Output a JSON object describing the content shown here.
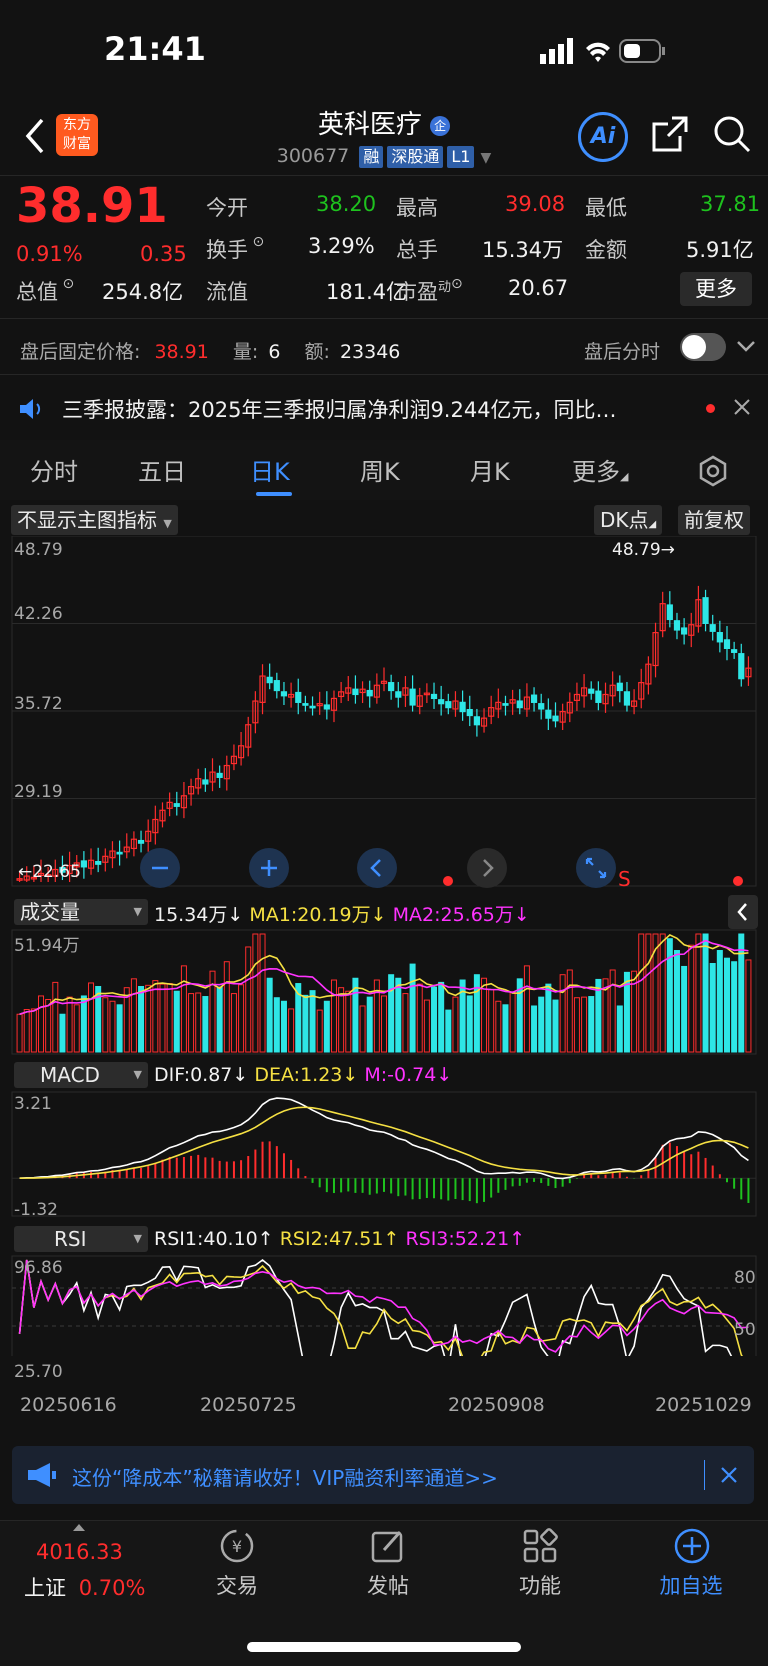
{
  "status": {
    "time": "21:41"
  },
  "header": {
    "logo_line1": "东方",
    "logo_line2": "财富",
    "title": "英科医疗",
    "title_badge": "企",
    "code": "300677",
    "tags": [
      "融",
      "深股通",
      "L1"
    ],
    "ai_label": "Ai"
  },
  "quote": {
    "price": "38.91",
    "change_pct": "0.91%",
    "change": "0.35",
    "open_label": "今开",
    "open": "38.20",
    "high_label": "最高",
    "high": "39.08",
    "low_label": "最低",
    "low": "37.81",
    "turnover_label": "换手",
    "turnover": "3.29%",
    "volume_label": "总手",
    "volume": "15.34万",
    "amount_label": "金额",
    "amount": "5.91亿",
    "mcap_label": "总值",
    "mcap": "254.8亿",
    "float_label": "流值",
    "float": "181.4亿",
    "pe_label": "市盈",
    "pe_sup": "动",
    "pe": "20.67",
    "more_label": "更多"
  },
  "afterhours": {
    "price_label": "盘后固定价格:",
    "price": "38.91",
    "qty_label": "量:",
    "qty": "6",
    "amt_label": "额:",
    "amt": "23346",
    "timeshare_label": "盘后分时"
  },
  "news": {
    "text": "三季报披露：2025年三季报归属净利润9.244亿元，同比…"
  },
  "tabs": [
    {
      "label": "分时"
    },
    {
      "label": "五日"
    },
    {
      "label": "日K"
    },
    {
      "label": "周K"
    },
    {
      "label": "月K"
    },
    {
      "label": "更多"
    }
  ],
  "chart_toolbar": {
    "indicator": "不显示主图指标",
    "dk": "DK点",
    "adjust": "前复权"
  },
  "chart_data": [
    {
      "type": "candlestick",
      "y_ticks": [
        "48.79",
        "42.26",
        "35.72",
        "29.19",
        "22.65"
      ],
      "ylim": [
        22.65,
        48.79
      ],
      "max_label": "48.79→",
      "min_label": "←22.65",
      "x_ticks": [
        "20250616",
        "20250725",
        "20250908",
        "20251029"
      ],
      "close": [
        22.9,
        23.1,
        23.0,
        23.3,
        23.2,
        23.6,
        23.4,
        23.9,
        24.1,
        23.8,
        24.3,
        24.0,
        24.6,
        25.0,
        24.8,
        25.3,
        25.9,
        25.6,
        26.5,
        27.4,
        28.1,
        28.7,
        28.4,
        29.2,
        29.9,
        30.5,
        30.1,
        31.0,
        30.6,
        31.5,
        32.2,
        33.0,
        34.6,
        36.4,
        38.3,
        37.8,
        37.2,
        36.8,
        36.9,
        36.3,
        36.1,
        35.9,
        36.2,
        35.8,
        36.6,
        37.1,
        37.4,
        36.9,
        37.3,
        36.8,
        37.6,
        37.9,
        37.2,
        36.7,
        37.4,
        36.1,
        36.8,
        37.0,
        36.6,
        36.2,
        35.9,
        36.4,
        35.6,
        35.3,
        34.6,
        35.1,
        35.9,
        36.3,
        36.1,
        36.5,
        35.9,
        36.7,
        36.3,
        35.8,
        35.1,
        34.9,
        35.6,
        36.3,
        36.9,
        37.4,
        37.0,
        36.3,
        36.9,
        37.6,
        37.2,
        36.1,
        36.4,
        37.8,
        39.2,
        41.6,
        43.8,
        42.6,
        41.8,
        41.5,
        42.2,
        44.1,
        42.3,
        41.7,
        40.9,
        40.4,
        40.1,
        38.1,
        38.9
      ],
      "volume_label": "成交量",
      "volume_value": "15.34万",
      "ma1": "MA1:20.19万",
      "ma2": "MA2:25.65万",
      "volume_max": "51.94万",
      "macd_label": "MACD",
      "dif": "DIF:0.87",
      "dea": "DEA:1.23",
      "m": "M:-0.74",
      "macd_max": "3.21",
      "macd_min": "-1.32",
      "rsi_label": "RSI",
      "rsi1": "RSI1:40.10",
      "rsi2": "RSI2:47.51",
      "rsi3": "RSI3:52.21",
      "rsi_max": "96.86",
      "rsi_min": "25.70",
      "rsi_80": "80",
      "rsi_50": "50",
      "colors": {
        "up": "#ff2d2d",
        "down": "#2ee6e6",
        "ma1": "#f5e043",
        "ma2": "#ff33ff",
        "dif": "#ffffff",
        "dea": "#f5e043"
      }
    }
  ],
  "promo": {
    "text": "这份“降成本”秘籍请收好！VIP融资利率通道>>"
  },
  "footer": {
    "index_value": "4016.33",
    "index_name": "上证",
    "index_change": "0.70%",
    "items": [
      {
        "label": "交易"
      },
      {
        "label": "发帖"
      },
      {
        "label": "功能"
      },
      {
        "label": "加自选"
      }
    ]
  }
}
